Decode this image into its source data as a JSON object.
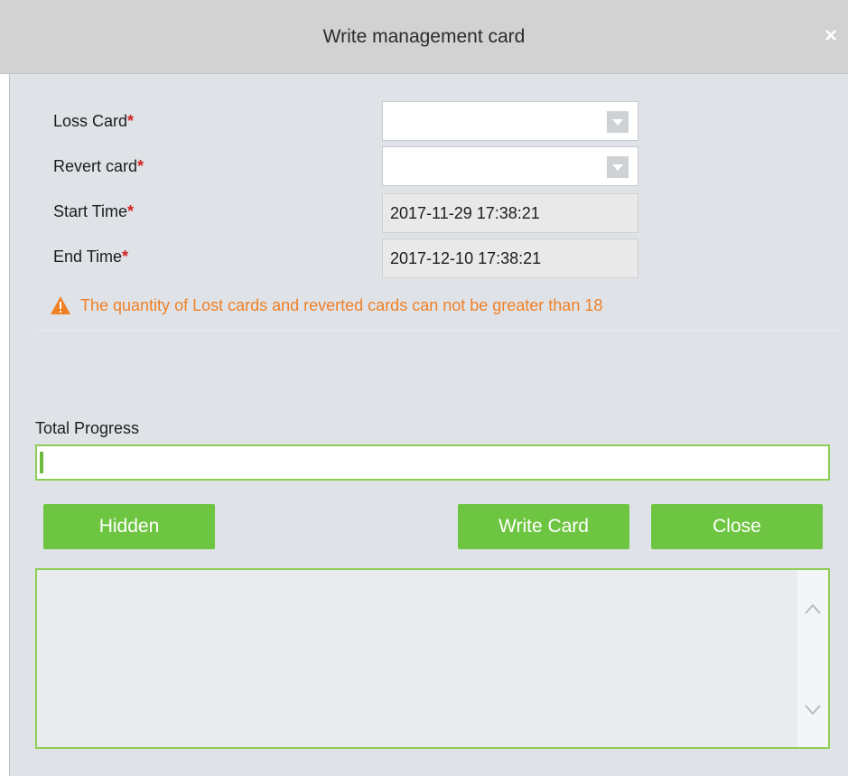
{
  "dialog": {
    "title": "Write management card",
    "close_symbol": "×"
  },
  "form": {
    "loss_card": {
      "label": "Loss Card",
      "required_mark": "*",
      "value": ""
    },
    "revert_card": {
      "label": "Revert card",
      "required_mark": "*",
      "value": ""
    },
    "start_time": {
      "label": "Start Time",
      "required_mark": "*",
      "value": "2017-11-29 17:38:21"
    },
    "end_time": {
      "label": "End Time",
      "required_mark": "*",
      "value": "2017-12-10 17:38:21"
    }
  },
  "warning": {
    "text": "The quantity of Lost cards and reverted cards can not be greater than 18",
    "icon": "warning-triangle-icon",
    "color": "#f07f24"
  },
  "progress": {
    "label": "Total Progress",
    "percent": 0.5
  },
  "buttons": {
    "hidden_label": "Hidden",
    "write_card_label": "Write Card",
    "close_label": "Close"
  },
  "colors": {
    "accent_green": "#6ec541",
    "panel_bg": "#dfe3e8",
    "title_bg": "#d2d2d2",
    "required_red": "#d12020"
  }
}
